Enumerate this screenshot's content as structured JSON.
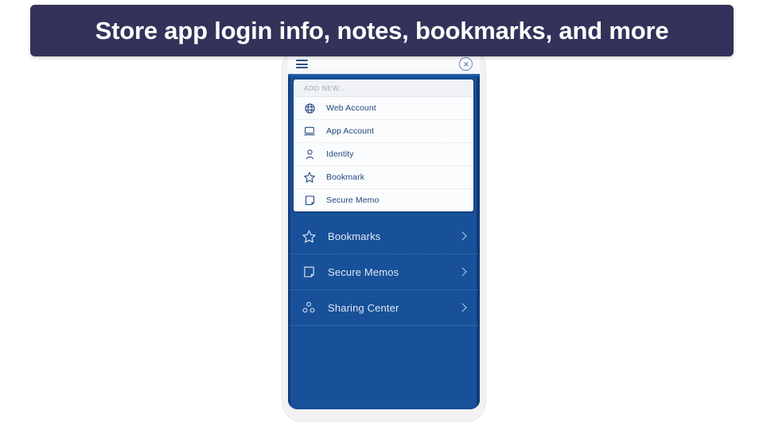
{
  "banner": {
    "text": "Store app login info, notes, bookmarks, and more",
    "background_color": "#32325a",
    "text_color": "#ffffff"
  },
  "phone": {
    "frame_color": "#f2f2f2",
    "screen_color": "#18519a"
  },
  "app_header": {
    "menu_icon": "hamburger-icon",
    "close_icon": "close-circle-icon"
  },
  "add_new_panel": {
    "title": "ADD NEW...",
    "items": [
      {
        "label": "Web Account",
        "icon": "globe-icon"
      },
      {
        "label": "App Account",
        "icon": "laptop-icon"
      },
      {
        "label": "Identity",
        "icon": "person-icon"
      },
      {
        "label": "Bookmark",
        "icon": "star-icon"
      },
      {
        "label": "Secure Memo",
        "icon": "memo-icon"
      }
    ]
  },
  "nav": {
    "items": [
      {
        "label": "Bookmarks",
        "icon": "star-icon",
        "chevron": "chevron-right-icon"
      },
      {
        "label": "Secure Memos",
        "icon": "memo-icon",
        "chevron": "chevron-right-icon"
      },
      {
        "label": "Sharing Center",
        "icon": "sharing-icon",
        "chevron": "chevron-right-icon"
      }
    ]
  },
  "colors": {
    "primary_blue": "#18519a",
    "dark_blue": "#123f7d",
    "navy": "#32325a",
    "nav_text": "#dfe7f2",
    "item_text": "#20477f",
    "muted_label": "#9aa7b8"
  }
}
